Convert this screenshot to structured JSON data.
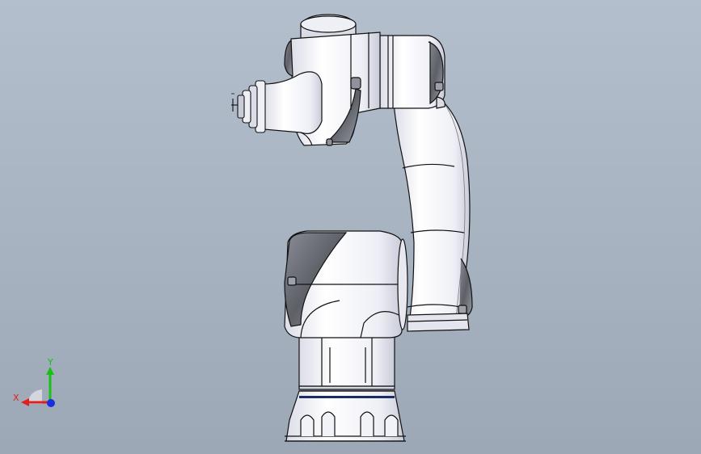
{
  "viewport": {
    "background_top": "#b3bfcc",
    "background_bottom": "#9ca8b5"
  },
  "model": {
    "body_color": "#f5f5fa",
    "shade_color": "#d7d9e6",
    "dark_cover_color": "#6e7078",
    "outline_color": "#111111"
  },
  "triad": {
    "x_label": "X",
    "y_label": "Y",
    "x_color": "#e02020",
    "y_color": "#18c018",
    "z_color": "#1a2ee0"
  }
}
